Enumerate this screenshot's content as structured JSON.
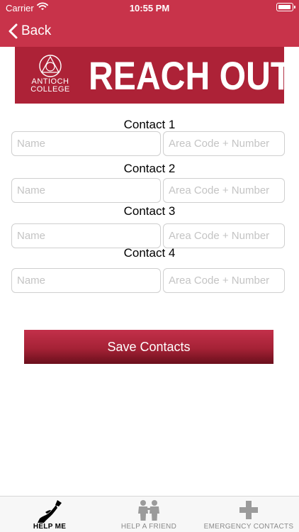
{
  "status_bar": {
    "carrier": "Carrier",
    "time": "10:55 PM"
  },
  "nav": {
    "back_label": "Back"
  },
  "banner": {
    "logo_line1": "ANTIOCH",
    "logo_line2": "COLLEGE",
    "title": "REACH OUT"
  },
  "contacts": [
    {
      "label": "Contact 1",
      "name_placeholder": "Name",
      "number_placeholder": "Area Code + Number",
      "name_value": "",
      "number_value": ""
    },
    {
      "label": "Contact 2",
      "name_placeholder": "Name",
      "number_placeholder": "Area Code + Number",
      "name_value": "",
      "number_value": ""
    },
    {
      "label": "Contact 3",
      "name_placeholder": "Name",
      "number_placeholder": "Area Code + Number",
      "name_value": "",
      "number_value": ""
    },
    {
      "label": "Contact 4",
      "name_placeholder": "Name",
      "number_placeholder": "Area Code + Number",
      "name_value": "",
      "number_value": ""
    }
  ],
  "save_button": {
    "label": "Save Contacts"
  },
  "tabs": [
    {
      "label": "HELP ME",
      "icon": "help-me-icon",
      "active": true
    },
    {
      "label": "HELP A FRIEND",
      "icon": "help-friend-icon",
      "active": false
    },
    {
      "label": "EMERGENCY CONTACTS",
      "icon": "emergency-cross-icon",
      "active": false
    }
  ],
  "colors": {
    "header": "#c8334a",
    "banner": "#ad2237",
    "button_top": "#c3304a",
    "button_bottom": "#6a0f1c",
    "tabbar": "#f7f7f7"
  }
}
